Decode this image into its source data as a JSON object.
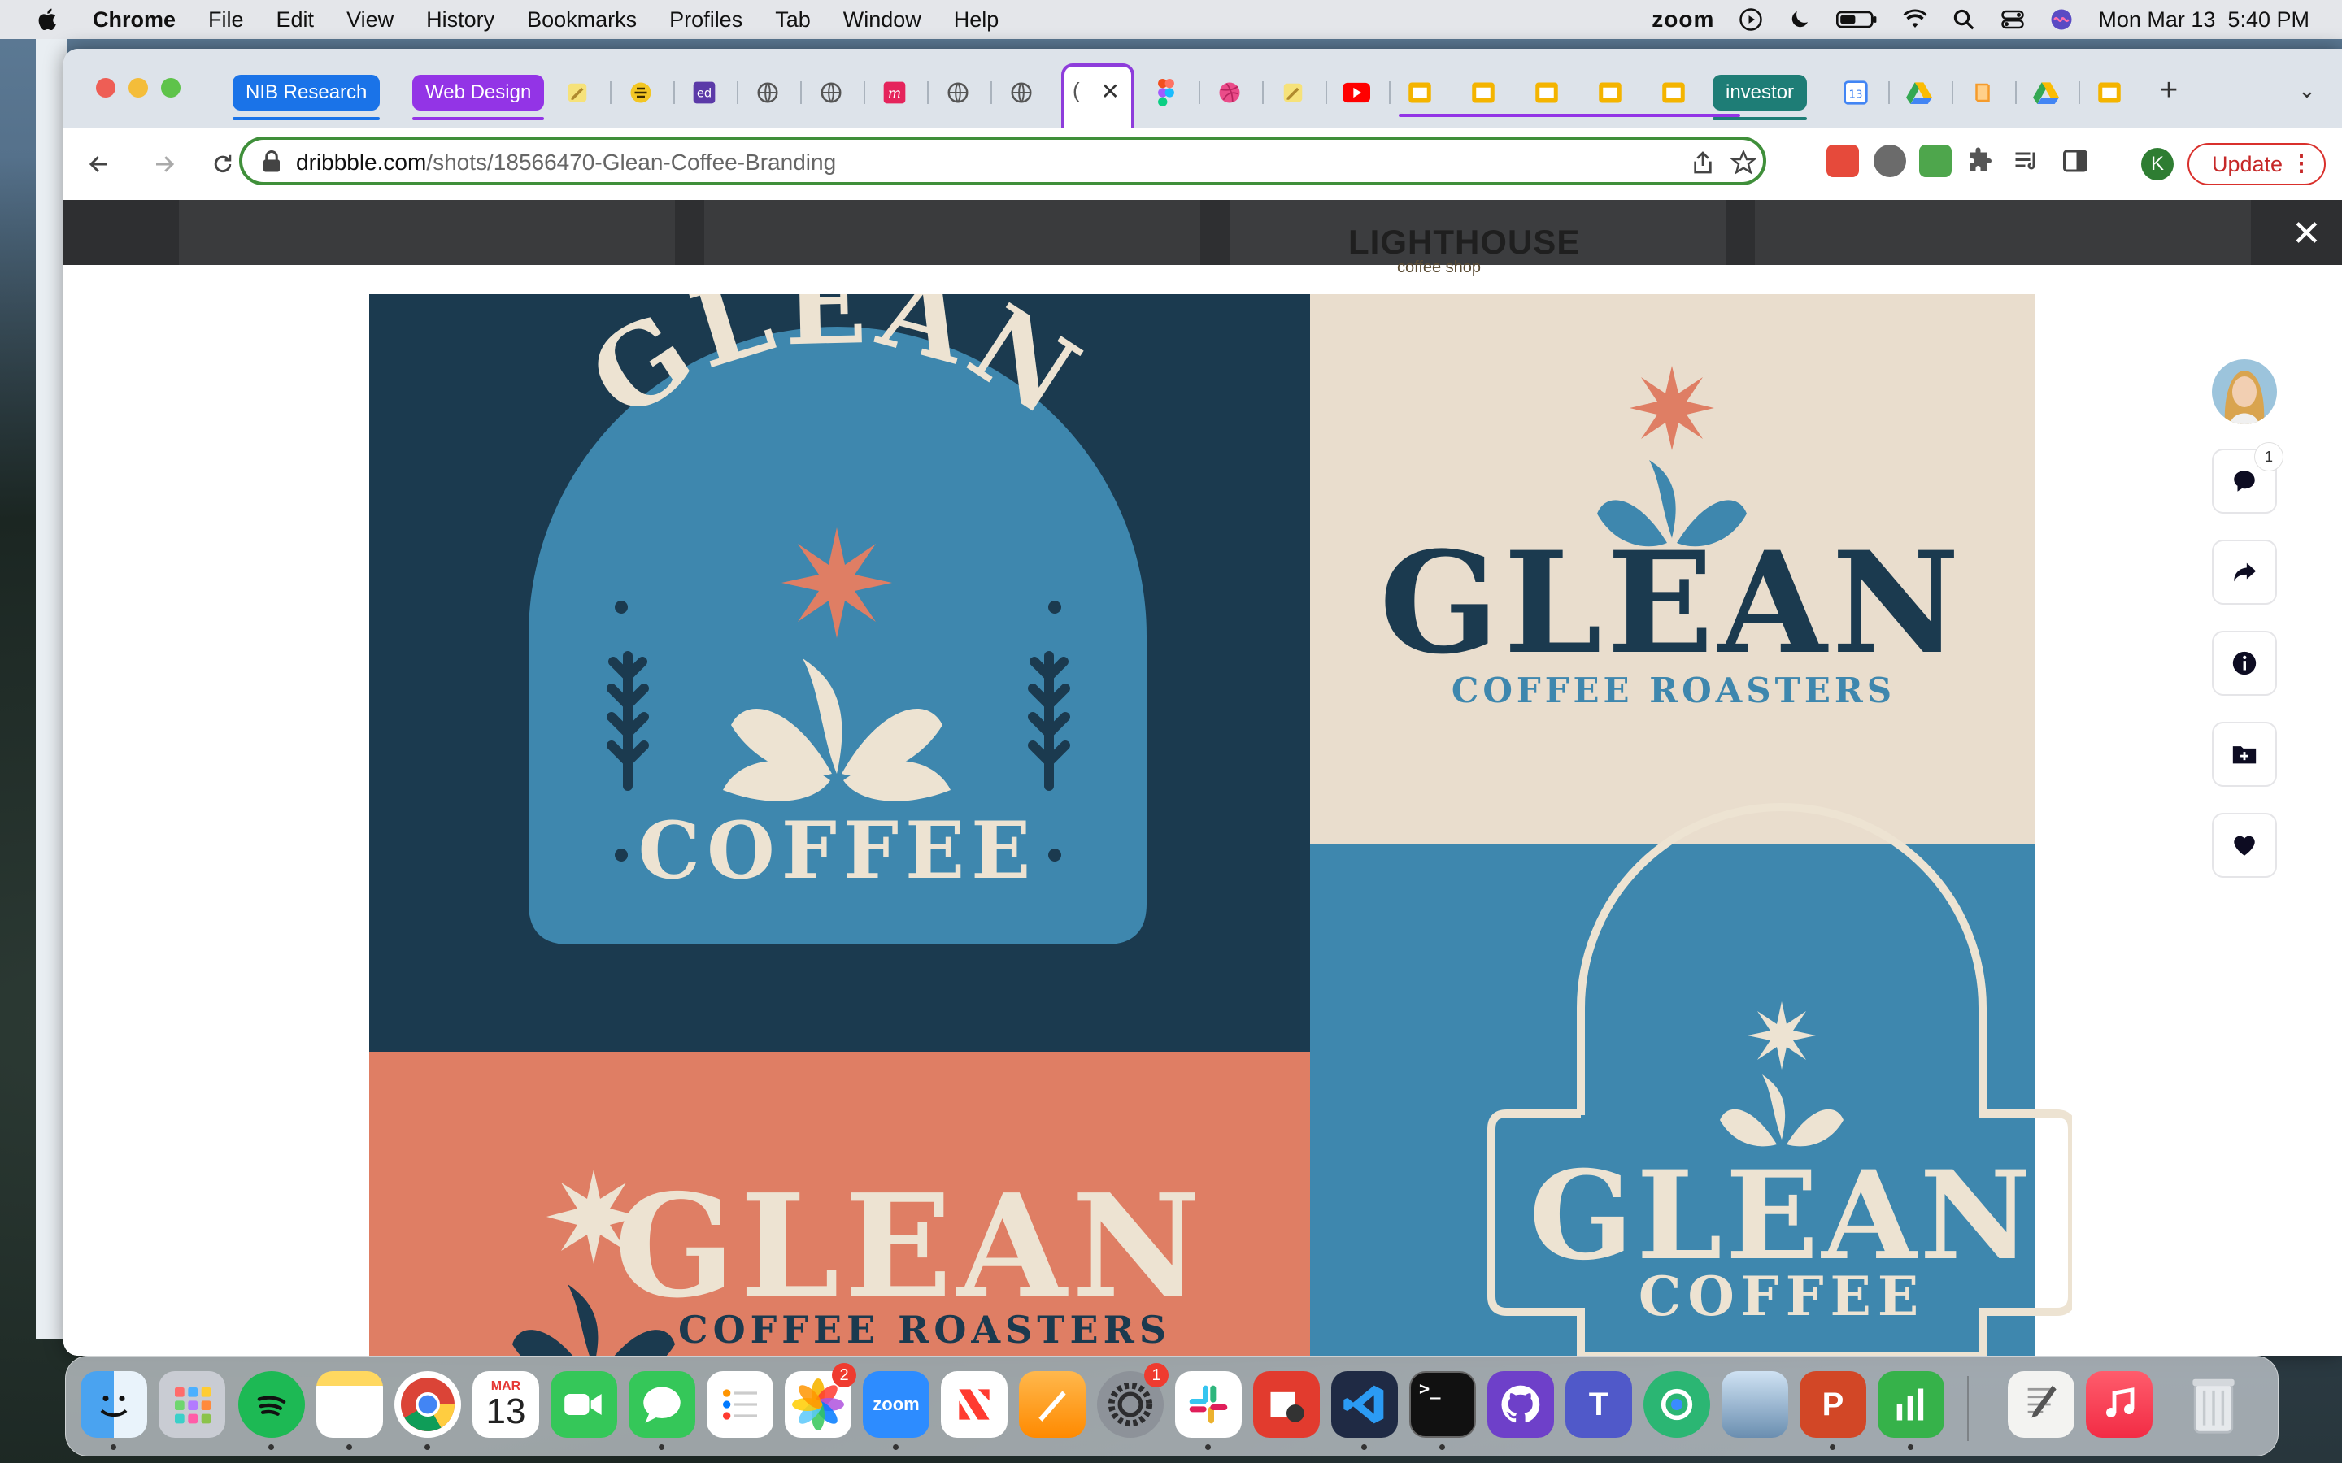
{
  "menubar": {
    "app_name": "Chrome",
    "items": [
      "File",
      "Edit",
      "View",
      "History",
      "Bookmarks",
      "Profiles",
      "Tab",
      "Window",
      "Help"
    ],
    "zoom_label": "zoom",
    "datetime": "Mon Mar 13  5:40 PM"
  },
  "tabs": {
    "groups": [
      {
        "label": "NIB Research",
        "color": "#1a73e8"
      },
      {
        "label": "Web Design",
        "color": "#9334e6"
      },
      {
        "label": "investor",
        "color": "#1e7d76"
      }
    ],
    "active_tab_letter": "(",
    "active_close": "✕",
    "new_tab": "+",
    "tab_list": "⌄"
  },
  "toolbar": {
    "url_host": "dribbble.com",
    "url_path": "/shots/18566470-Glean-Coffee-Branding",
    "profile_initial": "K",
    "update_label": "Update",
    "menu_dots": "⋮"
  },
  "page": {
    "bg_text": "LIGHTHOUSE",
    "bg_subtext": "coffee shop",
    "close_label": "✕",
    "comment_count": "1",
    "artwork": {
      "brand": "GLEAN",
      "coffee": "COFFEE",
      "roasters": "COFFEE ROASTERS",
      "colors": {
        "navy": "#1b3a4f",
        "blue": "#3e87ae",
        "cream": "#ede3d2",
        "coral": "#df7e64",
        "sand": "#e9ddcd"
      }
    }
  },
  "dock": {
    "calendar_month": "MAR",
    "calendar_day": "13",
    "photos_badge": "2",
    "settings_badge": "1",
    "zoom_label": "zoom"
  }
}
